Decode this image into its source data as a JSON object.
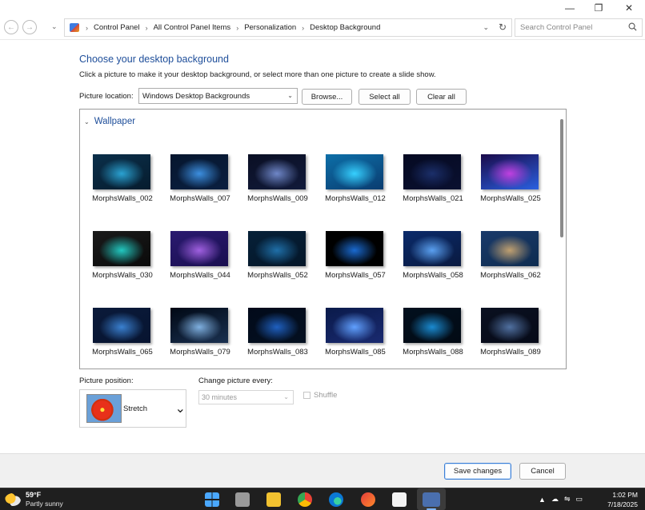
{
  "window": {
    "controls": {
      "minimize": "—",
      "maximize": "❐",
      "close": "✕"
    }
  },
  "nav": {
    "back_icon": "back-arrow-icon",
    "forward_icon": "forward-arrow-icon",
    "breadcrumbs": [
      "Control Panel",
      "All Control Panel Items",
      "Personalization",
      "Desktop Background"
    ],
    "search_placeholder": "Search Control Panel"
  },
  "main": {
    "heading": "Choose your desktop background",
    "subtext": "Click a picture to make it your desktop background, or select more than one picture to create a slide show.",
    "picture_location_label": "Picture location:",
    "picture_location_value": "Windows Desktop Backgrounds",
    "browse_label": "Browse...",
    "select_all_label": "Select all",
    "clear_all_label": "Clear all",
    "group_name": "Wallpaper",
    "wallpapers": [
      {
        "name": "MorphsWalls_002",
        "colors": [
          "#0b2f4a",
          "#2aa2d2",
          "#061c2e"
        ]
      },
      {
        "name": "MorphsWalls_007",
        "colors": [
          "#06162e",
          "#3c8fe0",
          "#0a1f40"
        ]
      },
      {
        "name": "MorphsWalls_009",
        "colors": [
          "#0a0f24",
          "#6f87c8",
          "#111a3a"
        ]
      },
      {
        "name": "MorphsWalls_012",
        "colors": [
          "#0d6fa8",
          "#36d0ff",
          "#0a3c70"
        ]
      },
      {
        "name": "MorphsWalls_021",
        "colors": [
          "#050a22",
          "#1b2f6a",
          "#0a1030"
        ]
      },
      {
        "name": "MorphsWalls_025",
        "colors": [
          "#1a0a4a",
          "#c040e0",
          "#2a60e0"
        ]
      },
      {
        "name": "MorphsWalls_030",
        "colors": [
          "#1a1a1a",
          "#22c8c0",
          "#0a0a0a"
        ]
      },
      {
        "name": "MorphsWalls_044",
        "colors": [
          "#2a1a70",
          "#a060e0",
          "#1a0f50"
        ]
      },
      {
        "name": "MorphsWalls_052",
        "colors": [
          "#062038",
          "#1f6fa8",
          "#041628"
        ]
      },
      {
        "name": "MorphsWalls_057",
        "colors": [
          "#000000",
          "#1a6ad0",
          "#000000"
        ]
      },
      {
        "name": "MorphsWalls_058",
        "colors": [
          "#0a2a6a",
          "#5aa0f0",
          "#0a1a40"
        ]
      },
      {
        "name": "MorphsWalls_062",
        "colors": [
          "#1a3a6a",
          "#c0a070",
          "#0e2c50"
        ]
      },
      {
        "name": "MorphsWalls_065",
        "colors": [
          "#0a1a3a",
          "#3a80d0",
          "#071430"
        ]
      },
      {
        "name": "MorphsWalls_079",
        "colors": [
          "#000814",
          "#7fb0e0",
          "#1a3050"
        ]
      },
      {
        "name": "MorphsWalls_083",
        "colors": [
          "#020a1a",
          "#1f60c0",
          "#041020"
        ]
      },
      {
        "name": "MorphsWalls_085",
        "colors": [
          "#0a1a4a",
          "#60a0ff",
          "#1a2a70"
        ]
      },
      {
        "name": "MorphsWalls_088",
        "colors": [
          "#02101e",
          "#1a8ad0",
          "#020a14"
        ]
      },
      {
        "name": "MorphsWalls_089",
        "colors": [
          "#0a1020",
          "#5070a0",
          "#060a18"
        ]
      }
    ],
    "picture_position_label": "Picture position:",
    "picture_position_value": "Stretch",
    "change_picture_label": "Change picture every:",
    "change_picture_value": "30 minutes",
    "shuffle_label": "Shuffle"
  },
  "footer": {
    "save_label": "Save changes",
    "cancel_label": "Cancel"
  },
  "taskbar": {
    "temperature": "59°F",
    "condition": "Partly sunny",
    "time": "1:02 PM",
    "date": "7/18/2025",
    "tray_icons": [
      "chevron-up-icon",
      "onedrive-icon",
      "network-volume-icon",
      "notification-icon"
    ]
  },
  "colors": {
    "heading": "#1e4e9a",
    "accent_border": "#3c7fd6",
    "taskbar": "#1f1f1f"
  }
}
